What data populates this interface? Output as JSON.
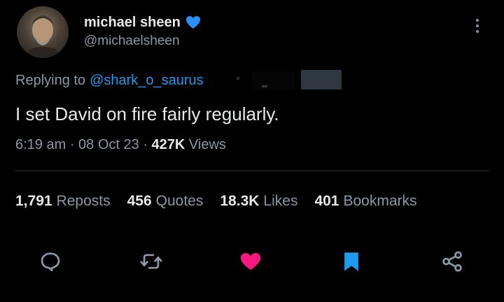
{
  "author": {
    "display_name": "michael sheen",
    "handle": "@michaelsheen",
    "verified_color": "#2b90f5",
    "avatar_icon": "user-avatar"
  },
  "reply": {
    "prefix": "Replying to",
    "mention": "@shark_o_saurus"
  },
  "tweet": {
    "text": "I set David on fire fairly regularly."
  },
  "meta": {
    "time": "6:19 am",
    "date": "08 Oct 23",
    "views_count": "427K",
    "views_label": "Views"
  },
  "stats": {
    "reposts_count": "1,791",
    "reposts_label": "Reposts",
    "quotes_count": "456",
    "quotes_label": "Quotes",
    "likes_count": "18.3K",
    "likes_label": "Likes",
    "bookmarks_count": "401",
    "bookmarks_label": "Bookmarks"
  },
  "colors": {
    "background": "#000000",
    "text_primary": "#e7e9ea",
    "text_secondary": "#8b98a5",
    "link": "#1d9bf0",
    "like": "#f91880",
    "bookmark": "#1d9bf0",
    "divider": "#2f3336"
  },
  "icons": [
    "reply-icon",
    "repost-icon",
    "like-icon",
    "bookmark-icon",
    "share-icon",
    "more-icon",
    "verified-icon"
  ]
}
